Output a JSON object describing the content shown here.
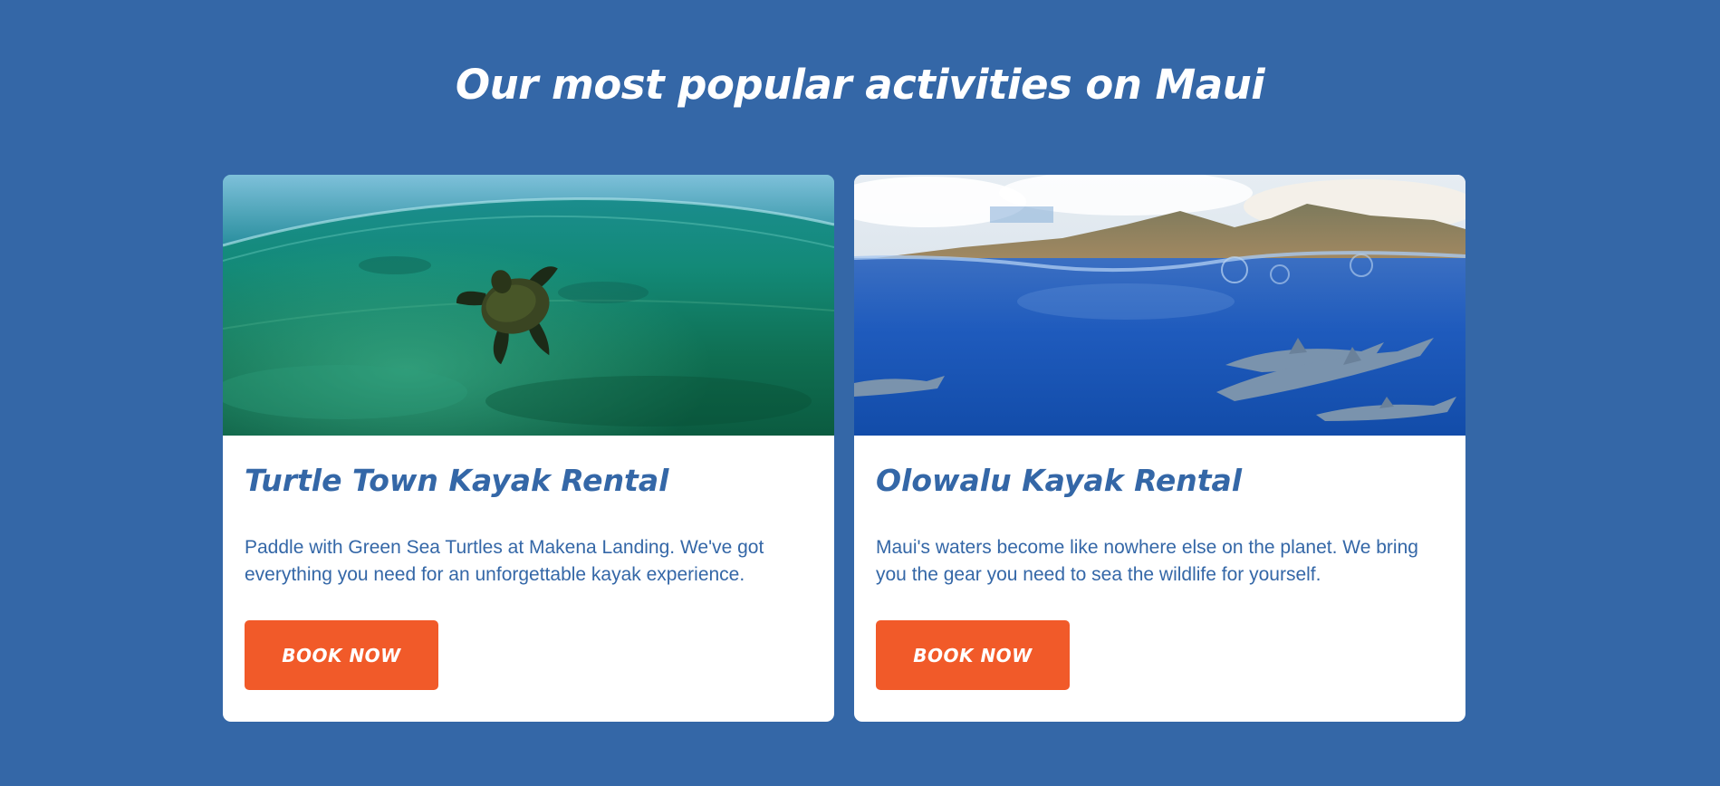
{
  "section": {
    "title": "Our most popular activities on Maui"
  },
  "colors": {
    "background": "#3467a7",
    "card": "#ffffff",
    "heading_text": "#3467a7",
    "button": "#f15a29",
    "button_text": "#ffffff"
  },
  "cards": [
    {
      "image": "sea-turtle-underwater-photo",
      "title": "Turtle Town Kayak Rental",
      "description": "Paddle with Green Sea Turtles at Makena Landing. We've got everything you need for an unforgettable kayak experience.",
      "button_label": "BOOK NOW"
    },
    {
      "image": "dolphins-mountains-split-view-photo",
      "title": "Olowalu Kayak Rental",
      "description": "Maui's waters become like nowhere else on the planet. We bring you the gear you need to sea the wildlife for yourself.",
      "button_label": "BOOK NOW"
    }
  ]
}
